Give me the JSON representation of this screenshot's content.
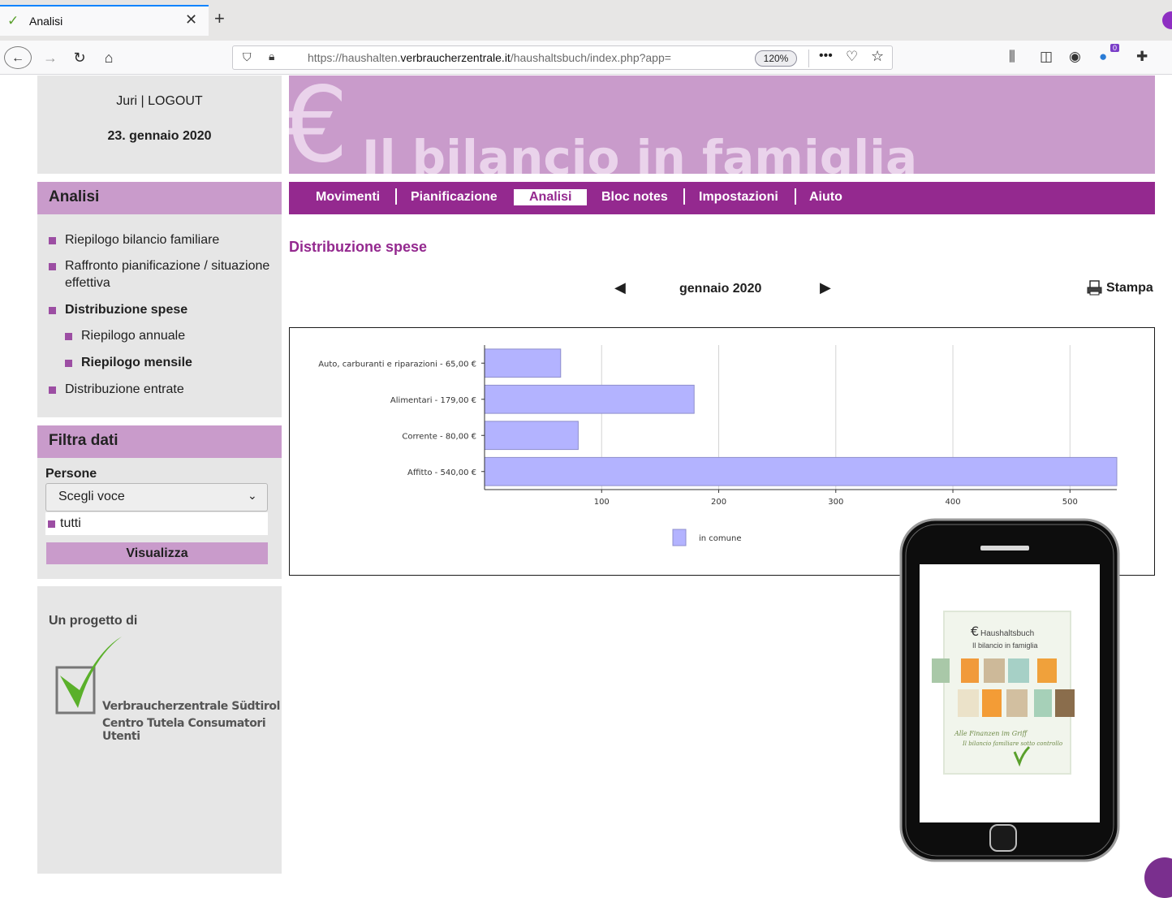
{
  "browser": {
    "tab_title": "Analisi",
    "url_prefix": "https://haushalten.",
    "url_domain": "verbraucherzentrale.it",
    "url_suffix": "/haushaltsbuch/index.php?app=",
    "zoom": "120%",
    "notification_count": "0"
  },
  "user": {
    "line": "Juri | LOGOUT",
    "date": "23. gennaio 2020"
  },
  "banner": {
    "title": "Il bilancio in famiglia"
  },
  "main_nav": {
    "items": [
      "Movimenti",
      "Pianificazione",
      "Analisi",
      "Bloc notes",
      "Impostazioni",
      "Aiuto"
    ],
    "active": "Analisi"
  },
  "sidebar": {
    "analisi_title": "Analisi",
    "items": [
      {
        "label": "Riepilogo bilancio familiare"
      },
      {
        "label": "Raffronto pianificazione / situazione effettiva"
      },
      {
        "label": "Distribuzione spese"
      },
      {
        "label": "Riepilogo annuale"
      },
      {
        "label": "Riepilogo mensile"
      },
      {
        "label": "Distribuzione entrate"
      }
    ],
    "filter_title": "Filtra dati",
    "persone_label": "Persone",
    "select_value": "Scegli voce",
    "tutti": "tutti",
    "visualizza": "Visualizza",
    "progetto_label": "Un progetto di",
    "org_name_1": "Verbraucherzentrale Südtirol",
    "org_name_2": "Centro Tutela Consumatori Utenti"
  },
  "page": {
    "section_title": "Distribuzione spese",
    "month": "gennaio 2020",
    "print_label": "Stampa"
  },
  "chart_data": {
    "type": "bar",
    "orientation": "horizontal",
    "categories": [
      "Auto, carburanti e riparazioni - 65,00 €",
      "Alimentari - 179,00 €",
      "Corrente - 80,00 €",
      "Affitto - 540,00 €"
    ],
    "series": [
      {
        "name": "in comune",
        "values": [
          65,
          179,
          80,
          540
        ]
      }
    ],
    "x_ticks": [
      100,
      200,
      300,
      400,
      500
    ],
    "xlim": [
      0,
      540
    ],
    "grid": true,
    "legend_position": "bottom-center",
    "bar_color": "#b3b3ff"
  },
  "phone_card": {
    "brand": "Haushaltsbuch",
    "subtitle": "Il bilancio in famiglia",
    "slogan_1": "Alle Finanzen im Griff",
    "slogan_2": "Il bilancio familiare sotto controllo"
  }
}
